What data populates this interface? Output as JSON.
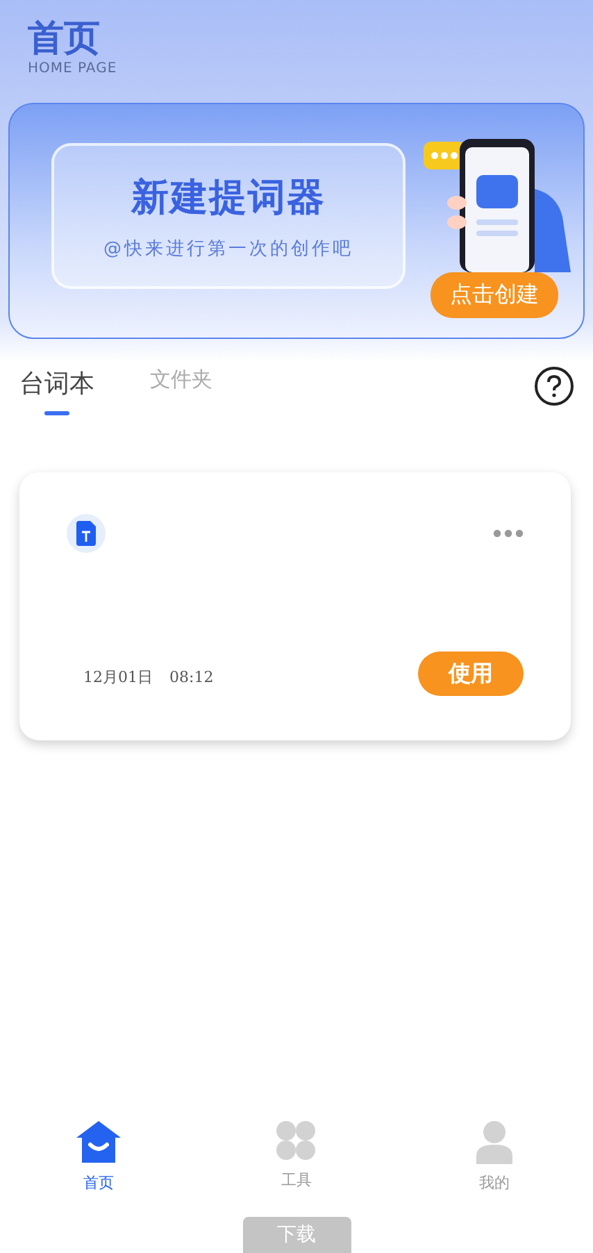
{
  "header": {
    "title": "首页",
    "subtitle": "HOME PAGE"
  },
  "banner": {
    "title": "新建提词器",
    "subtitle": "@快来进行第一次的创作吧",
    "button": "点击创建"
  },
  "tabs": [
    {
      "label": "台词本",
      "selected": true
    },
    {
      "label": "文件夹",
      "selected": false
    }
  ],
  "scripts": [
    {
      "date": "12月01日",
      "time": "08:12",
      "button": "使用"
    }
  ],
  "bottom_nav": [
    {
      "label": "首页",
      "kind": "home",
      "selected": true
    },
    {
      "label": "工具",
      "kind": "tools",
      "selected": false
    },
    {
      "label": "我的",
      "kind": "user",
      "selected": false
    }
  ],
  "download_button": "下载"
}
